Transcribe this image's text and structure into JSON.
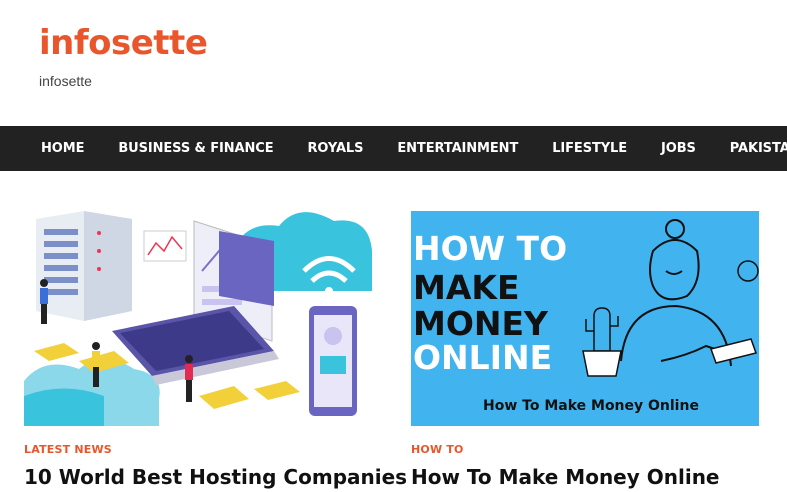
{
  "site": {
    "title": "infosette",
    "tagline": "infosette"
  },
  "nav": {
    "items": [
      {
        "label": "HOME"
      },
      {
        "label": "BUSINESS & FINANCE"
      },
      {
        "label": "ROYALS"
      },
      {
        "label": "ENTERTAINMENT"
      },
      {
        "label": "LIFESTYLE"
      },
      {
        "label": "JOBS"
      },
      {
        "label": "PAKISTAN"
      }
    ]
  },
  "posts": [
    {
      "category": "LATEST NEWS",
      "title": "10 World Best Hosting Companies",
      "image_icon": "hosting-illustration"
    },
    {
      "category": "HOW TO",
      "title": "How To Make Money Online",
      "image_text_lines": [
        "HOW TO",
        "MAKE",
        "MONEY",
        "ONLINE"
      ],
      "image_caption": "How To Make Money Online",
      "image_icon": "money-online-illustration"
    }
  ],
  "colors": {
    "accent": "#e9562b",
    "nav_bg": "#222222",
    "thumb2_bg": "#41b4f0"
  }
}
